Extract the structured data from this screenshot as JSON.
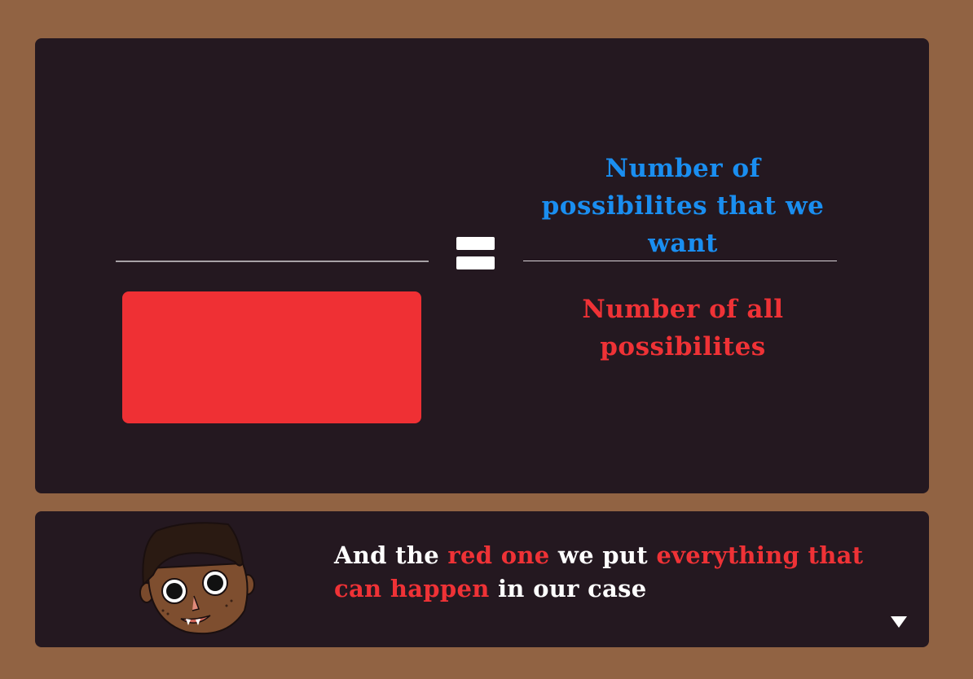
{
  "equation": {
    "numerator_label": "Number of possibilites that we want",
    "denominator_label": "Number of all possibilites"
  },
  "dialog": {
    "part1": "And the ",
    "part2": "red one",
    "part3": " we put ",
    "part4": "everything that can happen",
    "part5": " in our case"
  },
  "colors": {
    "background": "#916343",
    "panel": "#241820",
    "blue_text": "#1a8ef0",
    "red_accent": "#ef3034",
    "white_text": "#ffffff"
  },
  "icons": {
    "next": "triangle-down-icon",
    "character": "boy-avatar"
  }
}
